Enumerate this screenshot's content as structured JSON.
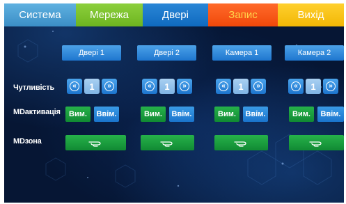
{
  "tabs": [
    {
      "label": "Система"
    },
    {
      "label": "Мережа"
    },
    {
      "label": "Двері"
    },
    {
      "label": "Запис"
    },
    {
      "label": "Вихід"
    }
  ],
  "columns": [
    {
      "title": "Двері 1",
      "sensitivity": "1",
      "md_on": "Вим.",
      "md_off": "Ввім."
    },
    {
      "title": "Двері 2",
      "sensitivity": "1",
      "md_on": "Вим.",
      "md_off": "Ввім."
    },
    {
      "title": "Камера 1",
      "sensitivity": "1",
      "md_on": "Вим.",
      "md_off": "Ввім."
    },
    {
      "title": "Камера 2",
      "sensitivity": "1",
      "md_on": "Вим.",
      "md_off": "Ввім."
    }
  ],
  "rows": {
    "sensitivity_label": "Чутливість",
    "md_activation_prefix": "MD",
    "md_activation_label": "активація",
    "md_zone_prefix": "MD",
    "md_zone_label": "зона"
  },
  "icons": {
    "decrease": "double-chevron-left-icon",
    "increase": "double-chevron-right-icon",
    "zone": "hand-pointer-icon"
  },
  "colors": {
    "active_tab": "#0f6abf",
    "record_tab_text": "#ffd34a",
    "green_button": "#118a33",
    "blue_button": "#1e76cf",
    "background": "#061634"
  }
}
